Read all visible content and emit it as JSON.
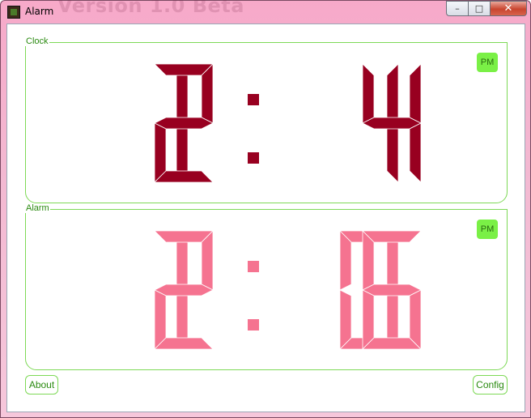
{
  "window": {
    "title": "Alarm",
    "watermark": "Version 1.0 Beta",
    "controls": {
      "minimize": "–",
      "maximize": "□",
      "close": "✕"
    }
  },
  "clock": {
    "label": "Clock",
    "time": "12:14",
    "ampm": "PM",
    "digit_color": "#980020"
  },
  "alarm": {
    "label": "Alarm",
    "time": "12:06",
    "ampm": "PM",
    "digit_color": "#f57390"
  },
  "buttons": {
    "about": "About",
    "config": "Config"
  },
  "colors": {
    "accent_green": "#7ed957",
    "pm_green": "#7af046"
  }
}
